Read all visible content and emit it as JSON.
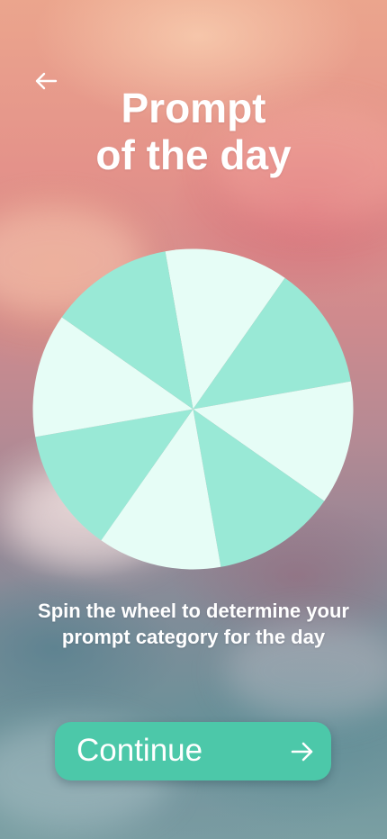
{
  "header": {
    "back_icon": "arrow-left-icon",
    "title_line1": "Prompt",
    "title_line2": "of the day"
  },
  "wheel": {
    "segment_count": 8,
    "colors": {
      "light": "#e6fdf6",
      "dark": "#99e9d6"
    }
  },
  "caption": "Spin the wheel to determine your prompt category for the day",
  "continue_button": {
    "label": "Continue",
    "icon": "arrow-right-icon",
    "color": "#4cc8a9"
  }
}
